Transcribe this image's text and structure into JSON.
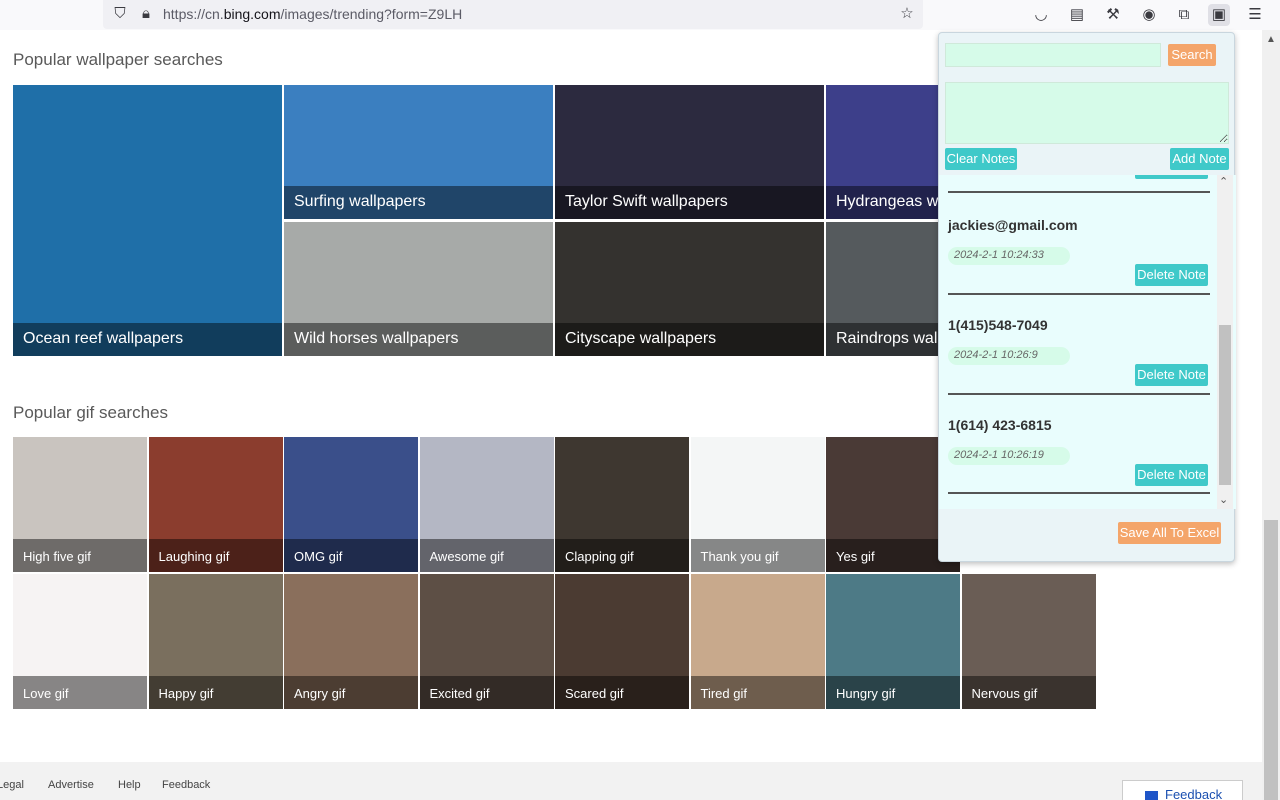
{
  "browser": {
    "url_prefix": "https://cn.",
    "url_domain": "bing.com",
    "url_suffix": "/images/trending?form=Z9LH"
  },
  "wallpapers": {
    "title": "Popular wallpaper searches",
    "items": [
      {
        "label": "Ocean reef wallpapers",
        "color": "#1f6fa8"
      },
      {
        "label": "Surfing wallpapers",
        "color": "#3b7fc0"
      },
      {
        "label": "Taylor Swift wallpapers",
        "color": "#2c2a3f"
      },
      {
        "label": "Hydrangeas wallpapers",
        "color": "#3d3f8a"
      },
      {
        "label": "Wild horses wallpapers",
        "color": "#a7aaa8"
      },
      {
        "label": "Cityscape wallpapers",
        "color": "#34322f"
      },
      {
        "label": "Raindrops wallpapers",
        "color": "#555a5d"
      }
    ]
  },
  "gifs": {
    "title": "Popular gif searches",
    "items": [
      {
        "label": "High five gif",
        "color": "#c9c4bf"
      },
      {
        "label": "Laughing gif",
        "color": "#8b3d2e"
      },
      {
        "label": "OMG gif",
        "color": "#3a4f8a"
      },
      {
        "label": "Awesome gif",
        "color": "#b4b7c4"
      },
      {
        "label": "Clapping gif",
        "color": "#3e3730"
      },
      {
        "label": "Thank you gif",
        "color": "#f4f6f6"
      },
      {
        "label": "Yes gif",
        "color": "#4a3a36"
      },
      {
        "label": "Love gif",
        "color": "#f6f3f3"
      },
      {
        "label": "Happy gif",
        "color": "#7a6f5e"
      },
      {
        "label": "Angry gif",
        "color": "#8a6f5c"
      },
      {
        "label": "Excited gif",
        "color": "#5d4f45"
      },
      {
        "label": "Scared gif",
        "color": "#4b3b32"
      },
      {
        "label": "Tired gif",
        "color": "#c8a98c"
      },
      {
        "label": "Hungry gif",
        "color": "#4d7a86"
      },
      {
        "label": "Nervous gif",
        "color": "#6a5d55"
      }
    ]
  },
  "footer": {
    "links": [
      "Legal",
      "Advertise",
      "Help",
      "Feedback"
    ],
    "feedback_button": "Feedback"
  },
  "popup": {
    "search_button": "Search",
    "clear_notes": "Clear Notes",
    "add_note": "Add Note",
    "notes": [
      {
        "text": "jackies@gmail.com",
        "date": "2024-2-1 10:24:33",
        "delete": "Delete Note"
      },
      {
        "text": "1(415)548-7049",
        "date": "2024-2-1 10:26:9",
        "delete": "Delete Note"
      },
      {
        "text": "1(614) 423-6815",
        "date": "2024-2-1 10:26:19",
        "delete": "Delete Note"
      }
    ],
    "save_button": "Save All To Excel"
  },
  "colors": {
    "popup_orange": "#f4a56a",
    "popup_teal": "#3fc9c9",
    "input_green": "#d6fbe9"
  }
}
